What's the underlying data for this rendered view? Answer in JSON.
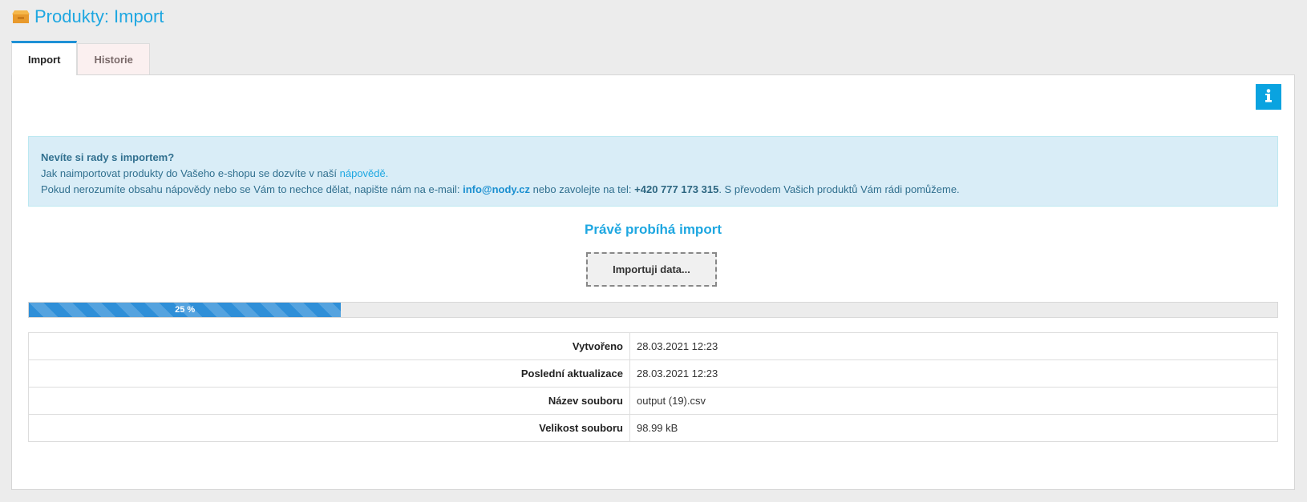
{
  "header": {
    "title": "Produkty: Import",
    "icon": "box-icon"
  },
  "tabs": [
    {
      "label": "Import",
      "active": true
    },
    {
      "label": "Historie",
      "active": false
    }
  ],
  "info_button": {
    "icon": "info-icon"
  },
  "alert": {
    "heading": "Nevíte si rady s importem?",
    "line1_text": "Jak naimportovat produkty do Vašeho e-shopu se dozvíte v naší ",
    "line1_link": "nápovědě.",
    "line2_text": "Pokud nerozumíte obsahu nápovědy nebo se Vám to nechce dělat, napište nám na e-mail: ",
    "email": "info@nody.cz",
    "line2_mid": " nebo zavolejte na tel: ",
    "phone": "+420 777 173 315",
    "line2_end": ". S převodem Vašich produktů Vám rádi pomůžeme."
  },
  "status": {
    "heading": "Právě probíhá import",
    "button_label": "Importuji data..."
  },
  "progress": {
    "value": 25,
    "label": "25 %"
  },
  "details": [
    {
      "label": "Vytvořeno",
      "value": "28.03.2021 12:23"
    },
    {
      "label": "Poslední aktualizace",
      "value": "28.03.2021 12:23"
    },
    {
      "label": "Název souboru",
      "value": "output (19).csv"
    },
    {
      "label": "Velikost souboru",
      "value": "98.99 kB"
    }
  ],
  "colors": {
    "accent": "#1ea7e1",
    "progress": "#2f8fd8",
    "alert_bg": "#d9edf7"
  }
}
